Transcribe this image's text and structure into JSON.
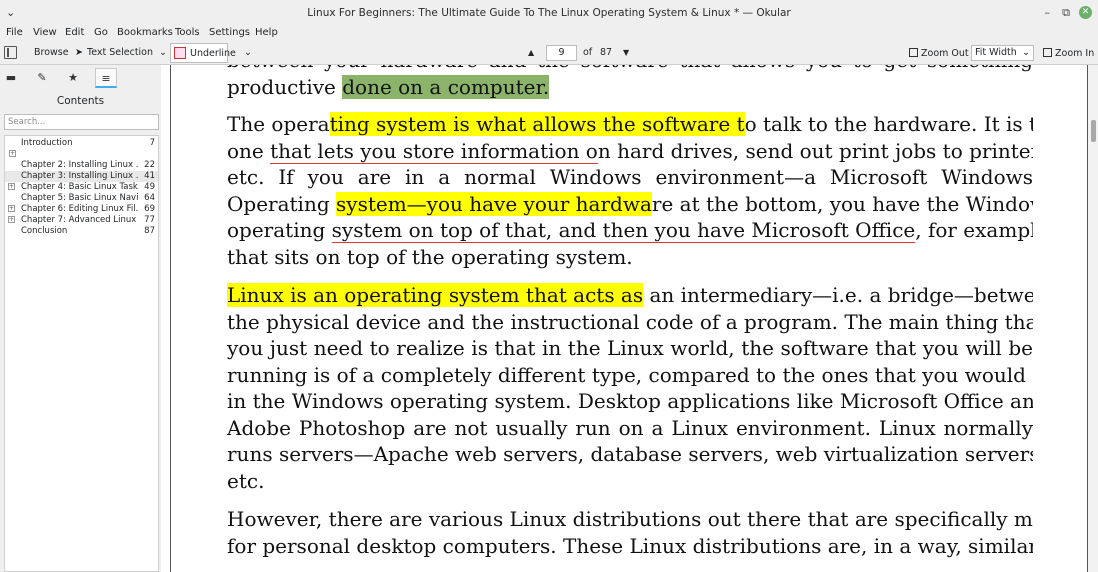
{
  "window": {
    "title": "Linux For Beginners: The Ultimate Guide To The Linux Operating System & Linux * — Okular",
    "menu_glyph": "⌄",
    "minimize": "–",
    "restore": "⧉",
    "close": "✕"
  },
  "menubar": [
    "File",
    "View",
    "Edit",
    "Go",
    "Bookmarks",
    "Tools",
    "Settings",
    "Help"
  ],
  "toolbar": {
    "browse": "Browse",
    "text_selection": "Text Selection",
    "annotation": "Underline",
    "page_current": "9",
    "page_of": "of",
    "page_total": "87",
    "zoom_out": "Zoom Out",
    "fit_mode": "Fit Width",
    "zoom_in": "Zoom In"
  },
  "sidebar": {
    "contents_title": "Contents",
    "search_placeholder": "Search...",
    "toc": [
      {
        "label": "Introduction",
        "page": "7",
        "expander": "",
        "selected": false
      },
      {
        "label": "",
        "page": "",
        "expander": "+",
        "selected": false
      },
      {
        "label": "Chapter 2: Installing Linux ...",
        "page": "22",
        "expander": "",
        "selected": false
      },
      {
        "label": "Chapter 3: Installing Linux ...",
        "page": "41",
        "expander": "",
        "selected": true
      },
      {
        "label": "Chapter 4: Basic Linux Task...",
        "page": "49",
        "expander": "+",
        "selected": false
      },
      {
        "label": "Chapter 5: Basic Linux Navi...",
        "page": "64",
        "expander": "",
        "selected": false
      },
      {
        "label": "Chapter 6: Editing Linux Fil...",
        "page": "69",
        "expander": "+",
        "selected": false
      },
      {
        "label": "Chapter 7: Advanced Linux ...",
        "page": "77",
        "expander": "+",
        "selected": false
      },
      {
        "label": "Conclusion",
        "page": "87",
        "expander": "",
        "selected": false
      }
    ]
  },
  "document": {
    "p0": {
      "l0": "between your hardware and the software that allows you to get something",
      "l1a": "productive ",
      "l1b": "done on a computer."
    },
    "p1": {
      "l0a": "The opera",
      "l0b": "ting system is what allows the software t",
      "l0c": "o talk to the hardware. It is the",
      "l1a": "one ",
      "l1b": "that lets you store information o",
      "l1c": "n hard drives, send out print jobs to printers,",
      "l2": "etc. If you are in a normal Windows environment—a Microsoft Windows",
      "l3a": "Operating ",
      "l3b": "system—you have your hardwa",
      "l3c": "re at the bottom, you have the Windows",
      "l4a": "operating ",
      "l4b": "system on top of that, and then you have Microsoft Office",
      "l4c": ", for example,",
      "l5": "that sits on top of the operating system."
    },
    "p2": {
      "l0a": "Linux is an operating system that acts as",
      "l0b": " an intermediary—i.e. a bridge—between",
      "l1": "the physical device and the instructional code of a program. The main thing that",
      "l2": "you just need to realize is that in the Linux world, the software that you will be",
      "l3": "running is of a completely different type, compared to the ones that you would run",
      "l4": "in the Windows operating system. Desktop applications like Microsoft Office and",
      "l5": "Adobe Photoshop are not usually run on a Linux environment. Linux normally",
      "l6": "runs servers—Apache web servers, database servers, web virtualization servers,",
      "l7": "etc."
    },
    "p3": {
      "l0": "However, there are various Linux distributions out there that are specifically made",
      "l1": "for personal desktop computers. These Linux distributions are, in a way, similar to"
    }
  },
  "colors": {
    "highlight_yellow": "#ffff00",
    "highlight_green": "#8cb36a",
    "underline_red": "#d33333",
    "accent": "#3daee9"
  }
}
